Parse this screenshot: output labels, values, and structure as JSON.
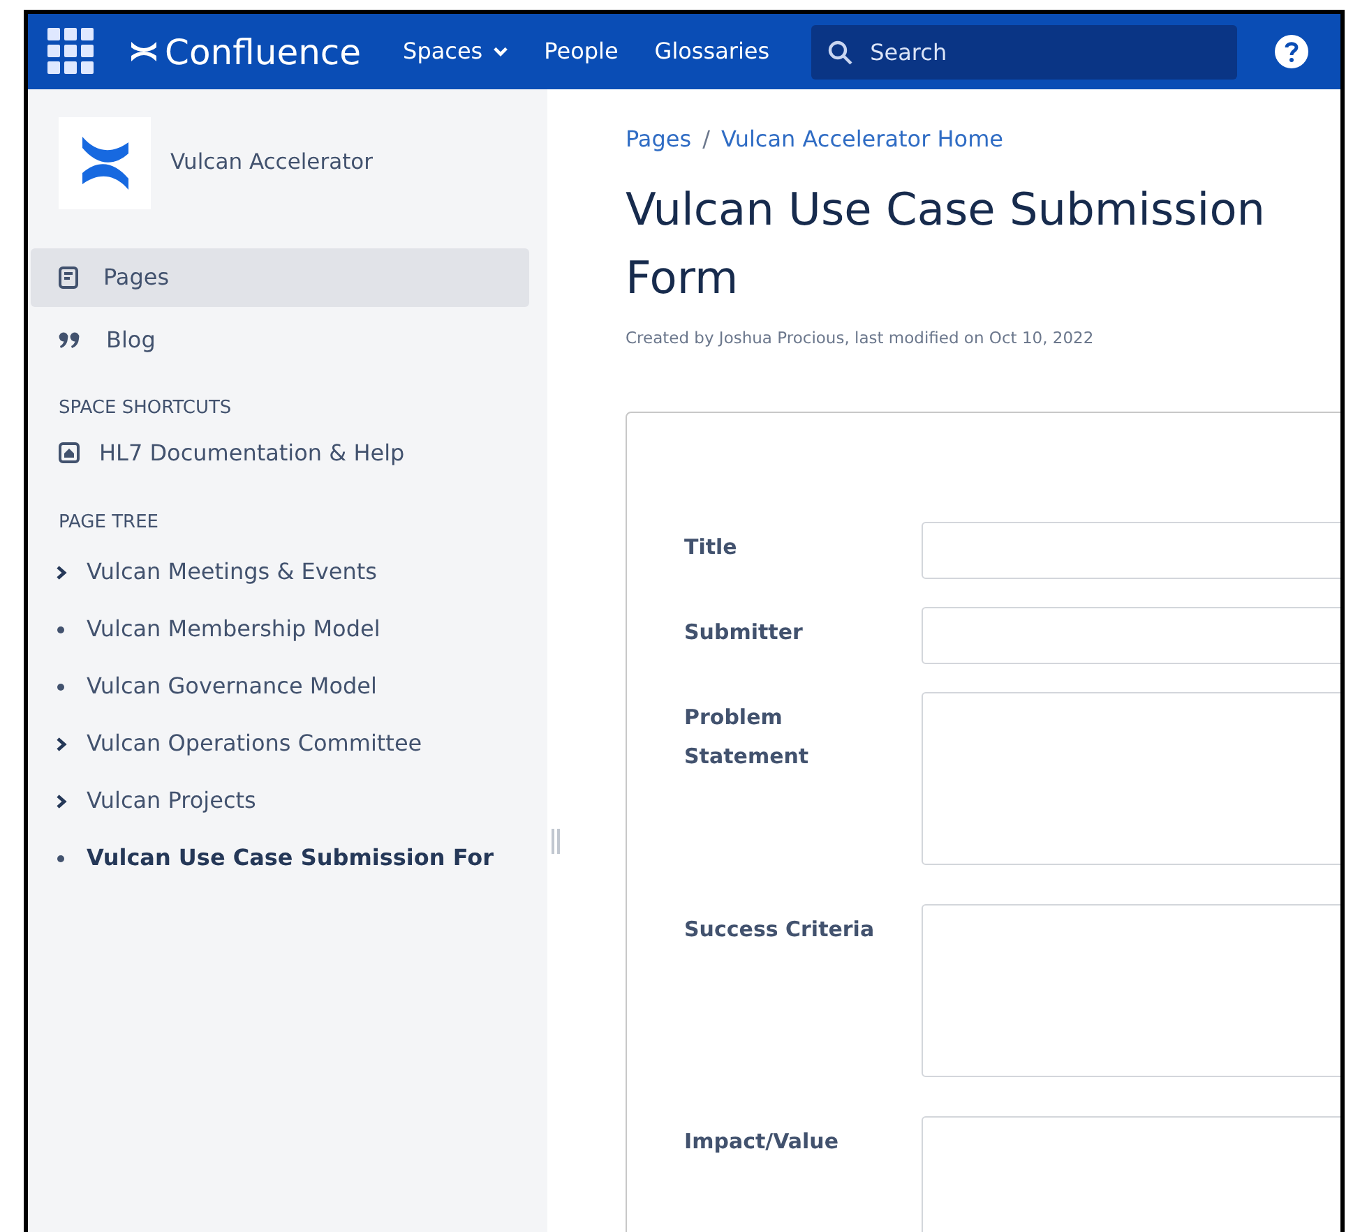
{
  "top_nav": {
    "product": "Confluence",
    "menu": [
      {
        "label": "Spaces",
        "dropdown": true
      },
      {
        "label": "People",
        "dropdown": false
      },
      {
        "label": "Glossaries",
        "dropdown": false
      }
    ],
    "search": {
      "placeholder": "Search"
    }
  },
  "sidebar": {
    "space_name": "Vulcan Accelerator",
    "nav": [
      {
        "label": "Pages",
        "kind": "pages",
        "selected": true
      },
      {
        "label": "Blog",
        "kind": "blog",
        "selected": false
      }
    ],
    "shortcuts_heading": "SPACE SHORTCUTS",
    "shortcuts": [
      {
        "label": "HL7 Documentation & Help"
      }
    ],
    "tree_heading": "PAGE TREE",
    "tree": [
      {
        "label": "Vulcan Meetings & Events",
        "kind": "expandable",
        "selected": false
      },
      {
        "label": "Vulcan Membership Model",
        "kind": "leaf",
        "selected": false
      },
      {
        "label": "Vulcan Governance Model",
        "kind": "leaf",
        "selected": false
      },
      {
        "label": "Vulcan Operations Committee",
        "kind": "expandable",
        "selected": false
      },
      {
        "label": "Vulcan Projects",
        "kind": "expandable",
        "selected": false
      },
      {
        "label": "Vulcan Use Case Submission For",
        "kind": "leaf",
        "selected": true
      }
    ]
  },
  "page": {
    "breadcrumbs": [
      "Pages",
      "Vulcan Accelerator Home"
    ],
    "breadcrumb_separator": "/",
    "title": "Vulcan Use Case Submission Form",
    "byline": "Created by Joshua Procious, last modified on Oct 10, 2022",
    "form": {
      "fields": [
        {
          "label": "Title",
          "kind": "line"
        },
        {
          "label": "Submitter",
          "kind": "line"
        },
        {
          "label": "Problem Statement",
          "kind": "area"
        },
        {
          "label": "Success Criteria",
          "kind": "area"
        },
        {
          "label": "Impact/Value",
          "kind": "area"
        }
      ]
    }
  }
}
